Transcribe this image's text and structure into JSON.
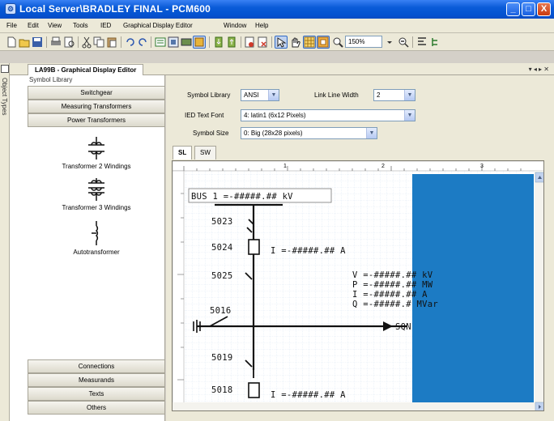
{
  "window": {
    "title": "Local Server\\BRADLEY FINAL - PCM600",
    "min_label": "_",
    "max_label": "□",
    "close_label": "X"
  },
  "menu": [
    "File",
    "Edit",
    "View",
    "Tools",
    "IED",
    "Graphical Display Editor",
    "Window",
    "Help"
  ],
  "toolbar": {
    "zoom": "150%",
    "icons": [
      "new-icon",
      "open-icon",
      "save-icon",
      "print-icon",
      "print-preview-icon",
      "cut-icon",
      "copy-icon",
      "paste-icon",
      "undo-icon",
      "redo-icon",
      "properties-icon",
      "settings-icon",
      "grid-icon",
      "frame-icon",
      "import-icon",
      "export-icon",
      "report-icon",
      "delete-icon",
      "pointer-icon",
      "hand-icon",
      "grid-toggle-icon",
      "snap-icon",
      "zoom-in-icon",
      "zoom-out-icon",
      "align-icon",
      "tree-icon"
    ]
  },
  "side": {
    "object_types": "Object Types"
  },
  "document": {
    "tab_title": "LA99B - Graphical Display Editor",
    "nav": "▾ ◂ ▸ ✕"
  },
  "symbol_library": {
    "title": "Symbol Library",
    "top_categories": [
      "Switchgear",
      "Measuring Transformers",
      "Power Transformers"
    ],
    "items": [
      "Transformer 2 Windings",
      "Transformer 3 Windings",
      "Autotransformer"
    ],
    "bottom_categories": [
      "Connections",
      "Measurands",
      "Texts",
      "Others"
    ]
  },
  "settings": {
    "symbol_library_label": "Symbol Library",
    "symbol_library_value": "ANSI",
    "link_line_width_label": "Link Line Width",
    "link_line_width_value": "2",
    "ied_text_font_label": "IED Text Font",
    "ied_text_font_value": "4: latin1 (6x12 Pixels)",
    "symbol_size_label": "Symbol Size",
    "symbol_size_value": "0: Big (28x28 pixels)"
  },
  "sheet_tabs": [
    "SL",
    "SW"
  ],
  "ruler": {
    "marks": [
      "1",
      "2",
      "3"
    ]
  },
  "diagram": {
    "bus": "BUS 1 =-#####.## kV",
    "b5023": "5023",
    "b5024": "5024",
    "b5024_value": "I =-#####.## A",
    "b5025": "5025",
    "meas_v": "V =-#####.## kV",
    "meas_p": "P =-#####.## MW",
    "meas_i": "I =-#####.## A",
    "meas_q": "Q =-#####.# MVar",
    "b5016": "5016",
    "sqn": "SQN",
    "b5019": "5019",
    "b5018": "5018",
    "b5018_value": "I =-#####.## A"
  },
  "colors": {
    "title_blue": "#0a5bd8",
    "canvas_fill": "#1c7bc4",
    "grid": "#c8d8ee"
  }
}
